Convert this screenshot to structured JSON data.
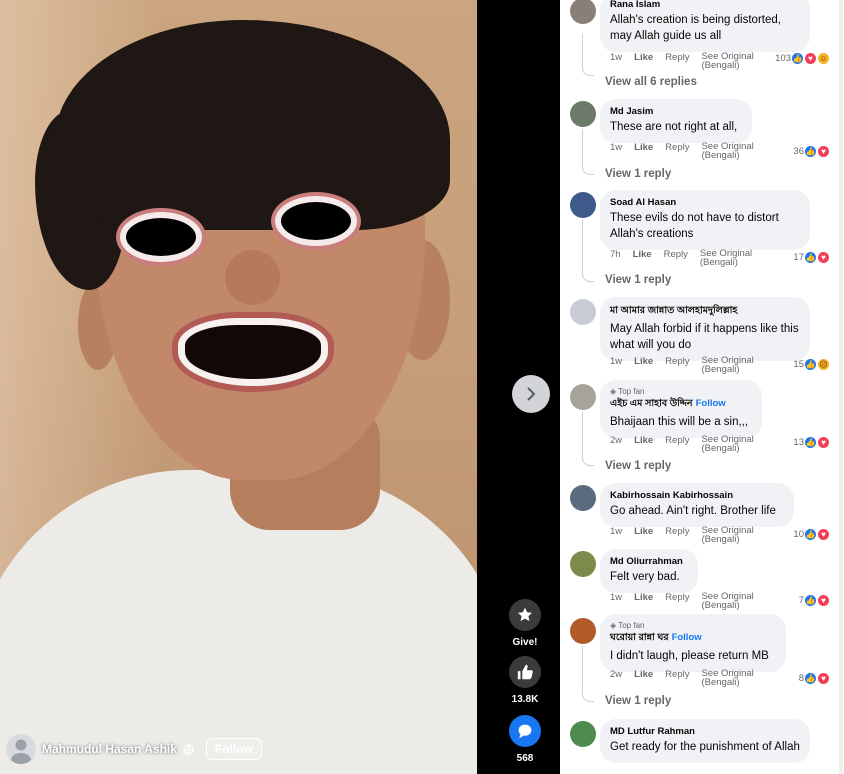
{
  "video": {
    "author_name": "Mahmudul Hasan Ashik",
    "follow_label": "Follow",
    "actions": [
      {
        "icon": "gift-star-icon",
        "label": "Give!"
      },
      {
        "icon": "thumbs-up-icon",
        "label": "13.8K"
      },
      {
        "icon": "comment-icon",
        "label": "568"
      }
    ],
    "next_icon": "chevron-right-icon"
  },
  "comments": [
    {
      "name": "Rana Islam",
      "text": "Allah's creation is being distorted, may Allah guide us all",
      "time": "1w",
      "like": "Like",
      "reply": "Reply",
      "see_original": "See Original",
      "lang": "(Bengali)",
      "count": "103",
      "reactions": [
        "like",
        "love",
        "haha"
      ],
      "view_replies": "View all 6 replies"
    },
    {
      "name": "Md Jasim",
      "text": "These are not right at all,",
      "time": "1w",
      "like": "Like",
      "reply": "Reply",
      "see_original": "See Original",
      "lang": "(Bengali)",
      "count": "36",
      "reactions": [
        "like",
        "love"
      ],
      "view_replies": "View 1 reply"
    },
    {
      "name": "Soad Al Hasan",
      "text": "These evils do not have to distort Allah's creations",
      "time": "7h",
      "like": "Like",
      "reply": "Reply",
      "see_original": "See Original",
      "lang": "(Bengali)",
      "count": "17",
      "reactions": [
        "like",
        "love"
      ],
      "view_replies": "View 1 reply"
    },
    {
      "name": "মা আমার জান্নাত আলহামদুলিল্লাহ",
      "text": "May Allah forbid if it happens like this what will you do",
      "time": "1w",
      "like": "Like",
      "reply": "Reply",
      "see_original": "See Original",
      "lang": "(Bengali)",
      "count": "15",
      "reactions": [
        "like",
        "sad"
      ],
      "view_replies": ""
    },
    {
      "badge": "Top fan",
      "name": "এইচ এম সাহাব উদ্দিন",
      "follow": "Follow",
      "text": "Bhaijaan this will be a sin,,,",
      "time": "2w",
      "like": "Like",
      "reply": "Reply",
      "see_original": "See Original",
      "lang": "(Bengali)",
      "count": "13",
      "reactions": [
        "like",
        "love"
      ],
      "view_replies": "View 1 reply"
    },
    {
      "name": "Kabirhossain Kabirhossain",
      "text": "Go ahead. Ain't right. Brother life",
      "time": "1w",
      "like": "Like",
      "reply": "Reply",
      "see_original": "See Original",
      "lang": "(Bengali)",
      "count": "10",
      "reactions": [
        "like",
        "love"
      ],
      "view_replies": ""
    },
    {
      "name": "Md Oliurrahman",
      "text": "Felt very bad.",
      "time": "1w",
      "like": "Like",
      "reply": "Reply",
      "see_original": "See Original",
      "lang": "(Bengali)",
      "count": "7",
      "reactions": [
        "like",
        "love"
      ],
      "view_replies": ""
    },
    {
      "badge": "Top fan",
      "name": "ঘরোয়া রান্না ঘর",
      "follow": "Follow",
      "text": "I didn't laugh, please return MB",
      "time": "2w",
      "like": "Like",
      "reply": "Reply",
      "see_original": "See Original",
      "lang": "(Bengali)",
      "count": "8",
      "reactions": [
        "like",
        "love"
      ],
      "view_replies": "View 1 reply"
    },
    {
      "name": "MD Lutfur Rahman",
      "text": "Get ready for the punishment of Allah",
      "time": "",
      "like": "",
      "reply": "",
      "see_original": "",
      "lang": "",
      "count": "",
      "reactions": [],
      "view_replies": ""
    }
  ],
  "colors": {
    "accent": "#1877f2",
    "love": "#f33e58",
    "bubble": "#f0f2f5"
  }
}
